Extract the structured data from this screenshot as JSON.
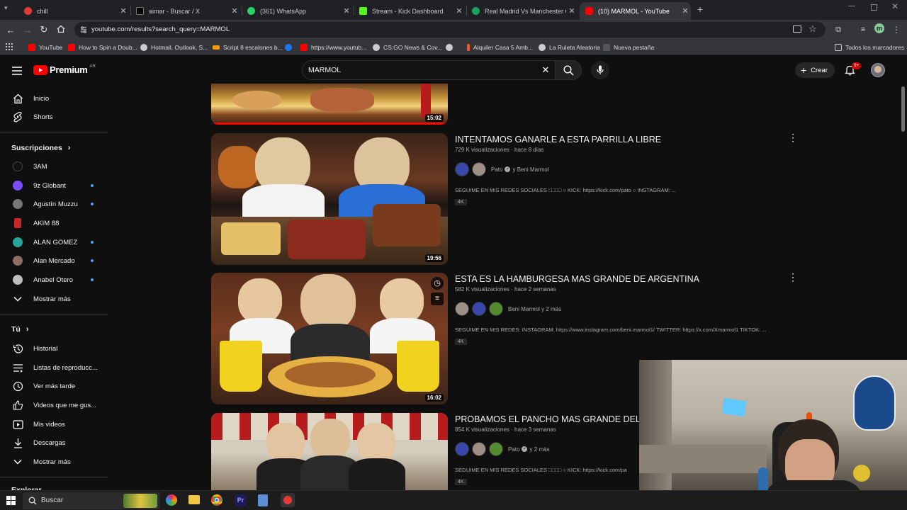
{
  "browser": {
    "tabs": [
      {
        "title": "chill",
        "color": "#e53935",
        "active": false
      },
      {
        "title": "aimar - Buscar / X",
        "color": "#000000",
        "active": false
      },
      {
        "title": "(361) WhatsApp",
        "color": "#25d366",
        "active": false
      },
      {
        "title": "Stream - Kick Dashboard",
        "color": "#53fc18",
        "active": false
      },
      {
        "title": "Real Madrid Vs Manchester City",
        "color": "#1aa260",
        "active": false
      },
      {
        "title": "(10) MARMOL - YouTube",
        "color": "#ff0000",
        "active": true
      }
    ],
    "new_tab": "+",
    "url": "youtube.com/results?search_query=MARMOL",
    "bookmarks": [
      {
        "label": "YouTube",
        "color": "#ff0000"
      },
      {
        "label": "How to Spin a Doub...",
        "color": "#ff0000"
      },
      {
        "label": "Hotmail, Outlook, S...",
        "color": "#cccccc"
      },
      {
        "label": "Script 8 escalones b...",
        "color": "#ff9800"
      },
      {
        "label": "",
        "color": "#1877f2"
      },
      {
        "label": "https://www.youtub...",
        "color": "#ff0000"
      },
      {
        "label": "CS:GO News & Cov...",
        "color": "#cccccc"
      },
      {
        "label": "",
        "color": "#cccccc"
      },
      {
        "label": "Alquiler Casa 5 Amb...",
        "color": "#ff5722"
      },
      {
        "label": "La Ruleta Aleatoria",
        "color": "#cccccc"
      },
      {
        "label": "Nueva pestaña",
        "color": "#555555"
      }
    ],
    "all_bookmarks": "Todos los marcadores",
    "profile_initial": "m"
  },
  "youtube": {
    "logo_text": "Premium",
    "logo_region": "AR",
    "search_value": "MARMOL",
    "create_label": "Crear",
    "notif_badge": "9+",
    "sidebar": {
      "main": [
        {
          "label": "Inicio",
          "icon": "home-icon"
        },
        {
          "label": "Shorts",
          "icon": "shorts-icon"
        }
      ],
      "subs_title": "Suscripciones",
      "subs": [
        {
          "label": "3AM",
          "color": "#111111",
          "dot": false
        },
        {
          "label": "9z Globant",
          "color": "#7c4dff",
          "dot": true
        },
        {
          "label": "Agustín Muzzu",
          "color": "#777777",
          "dot": true
        },
        {
          "label": "AKIM 88",
          "color": "#c62828",
          "dot": false
        },
        {
          "label": "ALAN GOMEZ",
          "color": "#26a69a",
          "dot": true
        },
        {
          "label": "Alan Mercado",
          "color": "#8d6e63",
          "dot": true
        },
        {
          "label": "Anabel Otero",
          "color": "#bdbdbd",
          "dot": true
        }
      ],
      "show_more": "Mostrar más",
      "you_title": "Tú",
      "you": [
        {
          "label": "Historial",
          "icon": "history-icon"
        },
        {
          "label": "Listas de reproducc...",
          "icon": "playlists-icon"
        },
        {
          "label": "Ver más tarde",
          "icon": "watch-later-icon"
        },
        {
          "label": "Videos que me gus...",
          "icon": "like-icon"
        },
        {
          "label": "Mis videos",
          "icon": "my-videos-icon"
        },
        {
          "label": "Descargas",
          "icon": "downloads-icon"
        }
      ],
      "show_more_2": "Mostrar más",
      "explore": "Explorar"
    },
    "results": [
      {
        "duration": "15:02"
      },
      {
        "title": "INTENTAMOS GANARLE A ESTA PARRILLA LIBRE",
        "views": "729 K visualizaciones",
        "age": "hace 8 días",
        "channel": "Pato",
        "channel_extra": "y Beni Marmol",
        "description": "SEGUIME EN MIS REDES SOCIALES □□□□ ○ KICK: https://kick.com/pato ○ INSTAGRAM: ...",
        "badge": "4K",
        "duration": "19:56"
      },
      {
        "title": "ESTA ES LA HAMBURGESA MAS GRANDE DE ARGENTINA",
        "views": "582 K visualizaciones",
        "age": "hace 2 semanas",
        "channel": "Beni Marmol y 2 más",
        "description": "SEGUIME EN MIS REDES: INSTAGRAM: https://www.instagram.com/beni.marmol1/ TWITTER: https://x.com/Xmarmol1 TIKTOK: ...",
        "badge": "4K",
        "duration": "16:02"
      },
      {
        "title": "PROBAMOS EL PANCHO MAS GRANDE DEL MUN",
        "views": "854 K visualizaciones",
        "age": "hace 3 semanas",
        "channel": "Pato",
        "channel_extra": "y 2 más",
        "description": "SEGUIME EN MIS REDES SOCIALES □□□□ ○ KICK: https://kick.com/pa",
        "badge": "4K"
      }
    ]
  },
  "taskbar": {
    "search_placeholder": "Buscar"
  }
}
